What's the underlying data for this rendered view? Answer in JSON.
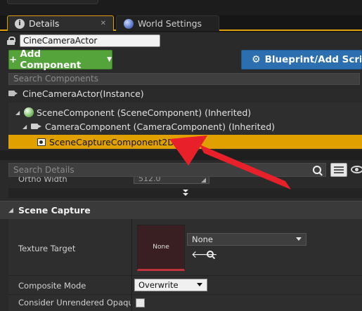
{
  "tabs": [
    {
      "label": "Details",
      "icon": "info-icon"
    },
    {
      "label": "World Settings",
      "icon": "globe-icon"
    }
  ],
  "actor_name": "CineCameraActor",
  "toolbar": {
    "add_component": "Add Component",
    "blueprint_script": "Blueprint/Add Script",
    "add_color": "#54a33b",
    "blueprint_color": "#2c6fb0"
  },
  "search_components_placeholder": "Search Components",
  "instance_label": "CineCameraActor(Instance)",
  "component_tree": [
    {
      "label": "SceneComponent (SceneComponent) (Inherited)",
      "icon": "sphere-icon"
    },
    {
      "label": "CameraComponent (CameraComponent) (Inherited)",
      "icon": "camera-icon"
    },
    {
      "label": "SceneCaptureComponent2D",
      "icon": "scene-capture-icon",
      "selected": true
    }
  ],
  "selection_color": "#e0a000",
  "search_details_placeholder": "Search Details",
  "ortho_width": {
    "label": "Ortho Width",
    "value": "512.0"
  },
  "category": "Scene Capture",
  "properties": {
    "texture_target": {
      "label": "Texture Target",
      "thumbnail_text": "None",
      "value": "None"
    },
    "composite_mode": {
      "label": "Composite Mode",
      "value": "Overwrite"
    },
    "consider_unrendered": {
      "label": "Consider Unrendered Opaque Pix",
      "checked": false
    }
  },
  "annotation_arrow_color": "#e8202a"
}
